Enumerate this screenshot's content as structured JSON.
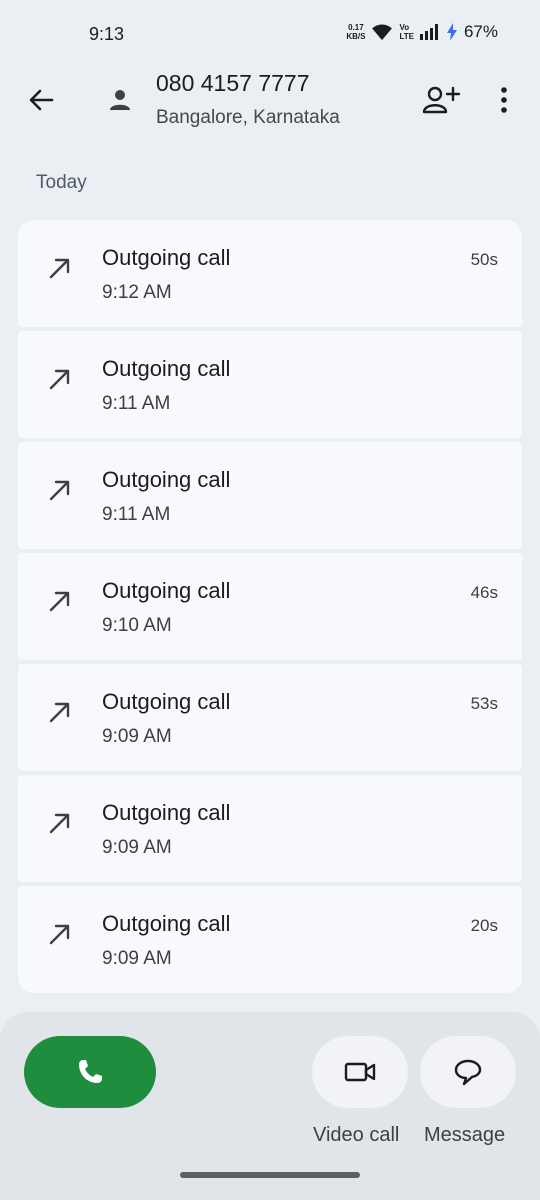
{
  "status_bar": {
    "time": "9:13",
    "net_speed_value": "0.17",
    "net_speed_unit": "KB/S",
    "volte_top": "Vo",
    "volte_bottom": "LTE",
    "battery": "67%"
  },
  "header": {
    "back_icon": "arrow-back-icon",
    "avatar_icon": "person-icon",
    "number": "080 4157 7777",
    "location": "Bangalore, Karnataka",
    "add_contact_icon": "person-add-icon",
    "more_icon": "more-vert-icon"
  },
  "section": {
    "label": "Today"
  },
  "calls": [
    {
      "type": "Outgoing call",
      "time": "9:12 AM",
      "duration": "50s"
    },
    {
      "type": "Outgoing call",
      "time": "9:11 AM",
      "duration": ""
    },
    {
      "type": "Outgoing call",
      "time": "9:11 AM",
      "duration": ""
    },
    {
      "type": "Outgoing call",
      "time": "9:10 AM",
      "duration": "46s"
    },
    {
      "type": "Outgoing call",
      "time": "9:09 AM",
      "duration": "53s"
    },
    {
      "type": "Outgoing call",
      "time": "9:09 AM",
      "duration": ""
    },
    {
      "type": "Outgoing call",
      "time": "9:09 AM",
      "duration": "20s"
    }
  ],
  "actions": {
    "call_icon": "phone-icon",
    "video_label": "Video call",
    "message_label": "Message"
  },
  "colors": {
    "call_button": "#1e8e3e",
    "background": "#ebeff4",
    "card": "#f7f9fc"
  }
}
